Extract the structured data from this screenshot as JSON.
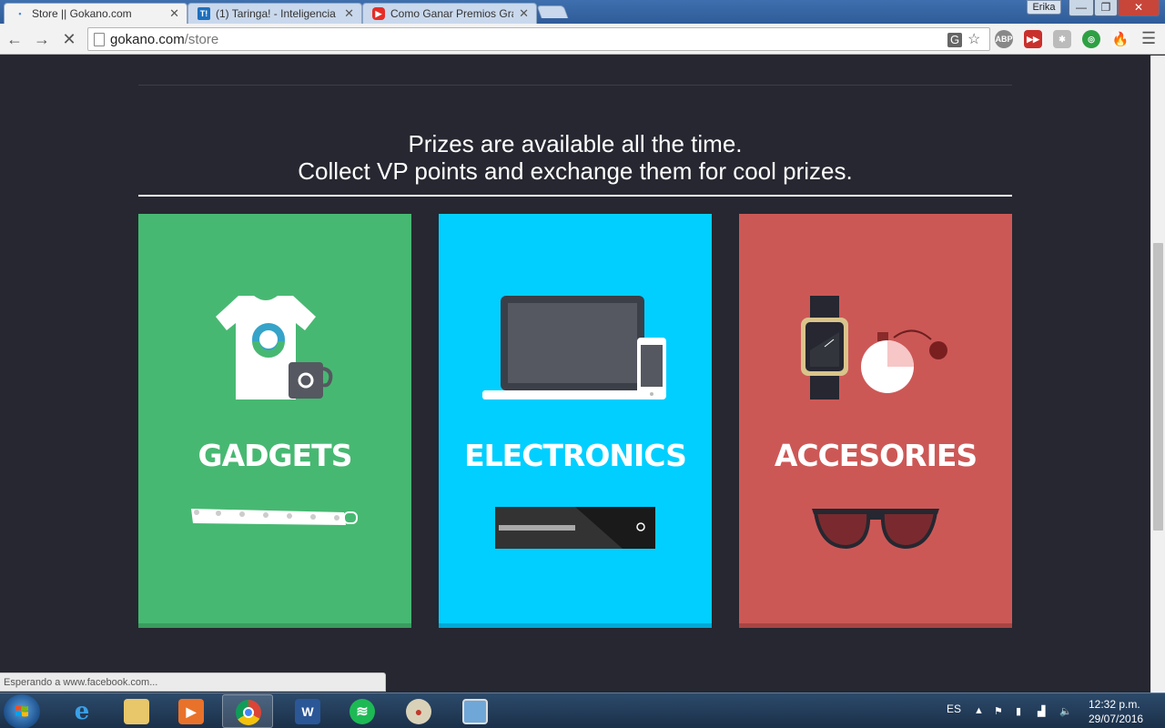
{
  "browser": {
    "tabs": [
      {
        "title": "Store || Gokano.com",
        "active": true
      },
      {
        "title": "(1) Taringa! - Inteligencia",
        "favicon": "T!",
        "active": false
      },
      {
        "title": "Como Ganar Premios Grat",
        "active": false
      }
    ],
    "window_user": "Erika",
    "url_host": "gokano.com",
    "url_path": "/store",
    "status_text": "Esperando a www.facebook.com..."
  },
  "page": {
    "headline_line1": "Prizes are available all the time.",
    "headline_line2": "Collect VP points and exchange them for cool prizes.",
    "cards": [
      {
        "label": "GADGETS",
        "color": "#47b872",
        "bar_color": "#3a9c5f",
        "icon": "tshirt-mug-icon",
        "icon2": "wristband-icon"
      },
      {
        "label": "ELECTRONICS",
        "color": "#00cfff",
        "bar_color": "#00a9d6",
        "icon": "laptop-phone-icon",
        "icon2": "console-icon"
      },
      {
        "label": "ACCESORIES",
        "color": "#cc5856",
        "bar_color": "#a84544",
        "icon": "watch-perfume-icon",
        "icon2": "sunglasses-icon"
      }
    ]
  },
  "taskbar": {
    "language": "ES",
    "time": "12:32 p.m.",
    "date": "29/07/2016",
    "apps": [
      "internet-explorer-icon",
      "file-explorer-icon",
      "media-player-icon",
      "chrome-icon",
      "word-icon",
      "spotify-icon",
      "paint-icon",
      "photo-viewer-icon"
    ]
  }
}
